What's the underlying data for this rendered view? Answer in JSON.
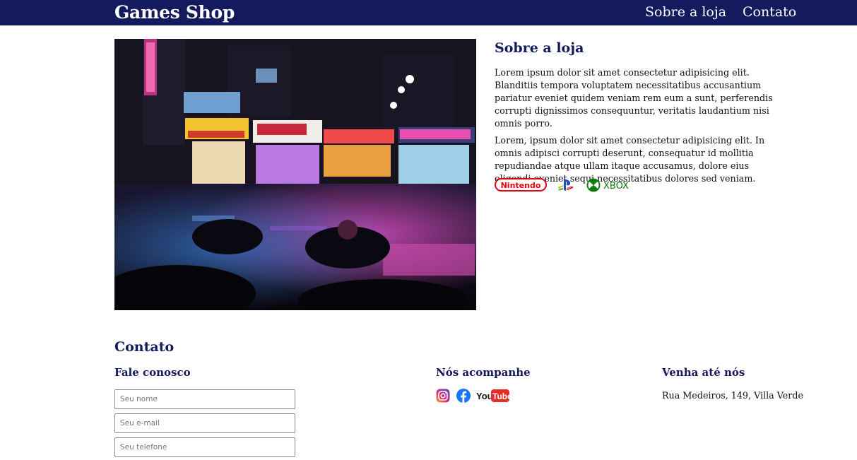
{
  "navbar": {
    "brand": "Games Shop",
    "links": [
      "Sobre a loja",
      "Contato"
    ],
    "background": "#141a5e"
  },
  "about": {
    "title": "Sobre a loja",
    "paragraphs": [
      "Lorem ipsum dolor sit amet consectetur adipisicing elit. Blanditiis tempora voluptatem necessitatibus accusantium pariatur eveniet quidem veniam rem eum a sunt, perferendis corrupti dignissimos consequuntur, veritatis laudantium nisi omnis porro.",
      "Lorem, ipsum dolor sit amet consectetur adipisicing elit. In omnis adipisci corrupti deserunt, consequatur id mollitia repudiandae atque ullam itaque accusamus, dolore eius eligendi eveniet sequi necessitatibus dolores sed veniam."
    ],
    "image_icon": "night-street-photo",
    "brands": {
      "nintendo": "Nintendo",
      "playstation_icon": "playstation-icon",
      "xbox": "XBOX"
    }
  },
  "contact": {
    "title": "Contato",
    "form": {
      "title": "Fale conosco",
      "name_placeholder": "Seu nome",
      "email_placeholder": "Seu e-mail",
      "phone_placeholder": "Seu telefone"
    },
    "social": {
      "title": "Nós acompanhe",
      "icons": [
        "instagram-icon",
        "facebook-icon",
        "youtube-icon"
      ],
      "youtube_you": "You",
      "youtube_tube": "Tube"
    },
    "location": {
      "title": "Venha até nós",
      "address": "Rua Medeiros, 149, Villa Verde"
    }
  },
  "colors": {
    "primary": "#141a5e",
    "nintendo_red": "#e60012",
    "xbox_green": "#107c10",
    "facebook_blue": "#1877f2",
    "youtube_red": "#e52d27"
  }
}
